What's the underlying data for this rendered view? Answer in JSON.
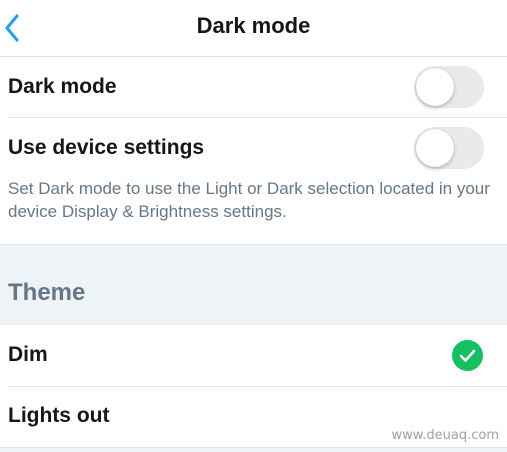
{
  "nav": {
    "title": "Dark mode",
    "back_icon": "chevron-left-icon",
    "accent_color": "#1da1f2"
  },
  "settings": {
    "dark_mode": {
      "label": "Dark mode",
      "enabled": false
    },
    "use_device_settings": {
      "label": "Use device settings",
      "enabled": false
    },
    "helper_text": "Set Dark mode to use the Light or Dark selection located in your device Display & Brightness settings."
  },
  "theme": {
    "section_title": "Theme",
    "options": [
      {
        "label": "Dim",
        "selected": true
      },
      {
        "label": "Lights out",
        "selected": false
      }
    ],
    "check_icon": "checkmark-circle-icon",
    "check_color": "#17bf63"
  },
  "watermark": "www.deuaq.com"
}
